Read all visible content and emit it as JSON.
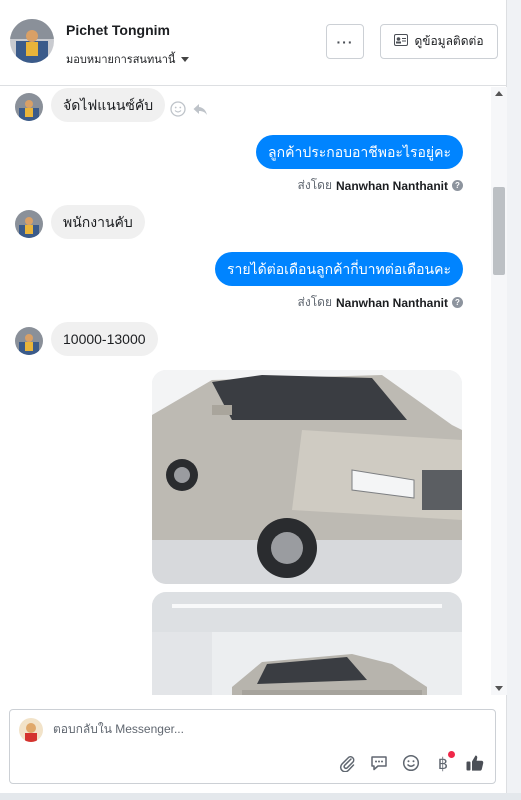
{
  "header": {
    "name": "Pichet Tongnim",
    "assign_label": "มอบหมายการสนทนานี้",
    "more_label": "···",
    "contact_label": "ดูข้อมูลติดต่อ"
  },
  "messages": [
    {
      "side": "in",
      "text": "จัดไฟแนนซ์คับ"
    },
    {
      "side": "out",
      "text": "ลูกค้าประกอบอาชีพอะไรอยู่คะ"
    },
    {
      "side": "in",
      "text": "พนักงานคับ"
    },
    {
      "side": "out",
      "text": "รายได้ต่อเดือนลูกค้ากี่บาทต่อเดือนคะ"
    },
    {
      "side": "in",
      "text": "10000-13000"
    }
  ],
  "sent_by": {
    "prefix": "ส่งโดย",
    "name": "Nanwhan Nanthanit"
  },
  "composer": {
    "placeholder": "ตอบกลับใน Messenger..."
  },
  "icons": {
    "header": [
      "more-icon",
      "contact-card-icon"
    ],
    "message_actions": [
      "emoji-reaction-icon",
      "reply-icon"
    ],
    "composer": [
      "attachment-icon",
      "saved-reply-icon",
      "emoji-icon",
      "baht-payment-icon",
      "like-icon"
    ]
  },
  "colors": {
    "accent": "#0084ff",
    "incoming_bubble": "#f0f0f0",
    "notification": "#f02849"
  }
}
